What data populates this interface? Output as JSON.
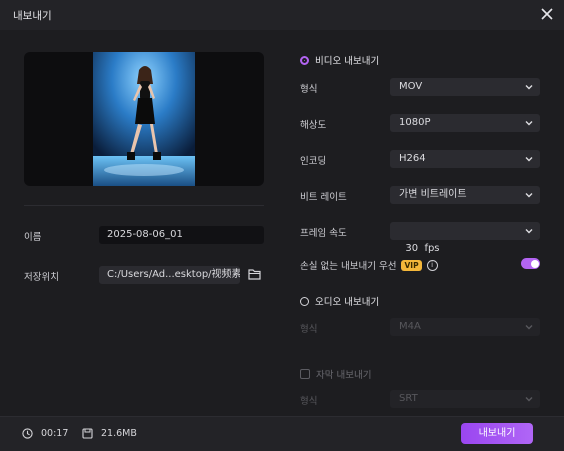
{
  "window": {
    "title": "내보내기"
  },
  "left": {
    "name_label": "이름",
    "name_value": "2025-08-06_01",
    "location_label": "저장위치",
    "location_value": "C:/Users/Ad...esktop/视频素材"
  },
  "video": {
    "section_label": "비디오 내보내기",
    "format_label": "형식",
    "format_value": "MOV",
    "resolution_label": "해상도",
    "resolution_value": "1080P",
    "encoding_label": "인코딩",
    "encoding_value": "H264",
    "bitrate_label": "비트 레이트",
    "bitrate_value": "가변 비트레이트",
    "framerate_label": "프레임 속도",
    "framerate_value": "30  fps",
    "lossless_label": "손실 없는 내보내기 우선",
    "vip_badge": "VIP",
    "info_glyph": "i",
    "lossless_enabled": true
  },
  "audio": {
    "section_label": "오디오 내보내기",
    "format_label": "형식",
    "format_value": "M4A"
  },
  "subtitle": {
    "section_label": "자막 내보내기",
    "format_label": "형식",
    "format_value": "SRT"
  },
  "footer": {
    "duration": "00:17",
    "size": "21.6MB",
    "export_label": "내보내기"
  },
  "colors": {
    "accent": "#b364f2",
    "vip": "#f4b73a",
    "background": "#1d1d20"
  }
}
